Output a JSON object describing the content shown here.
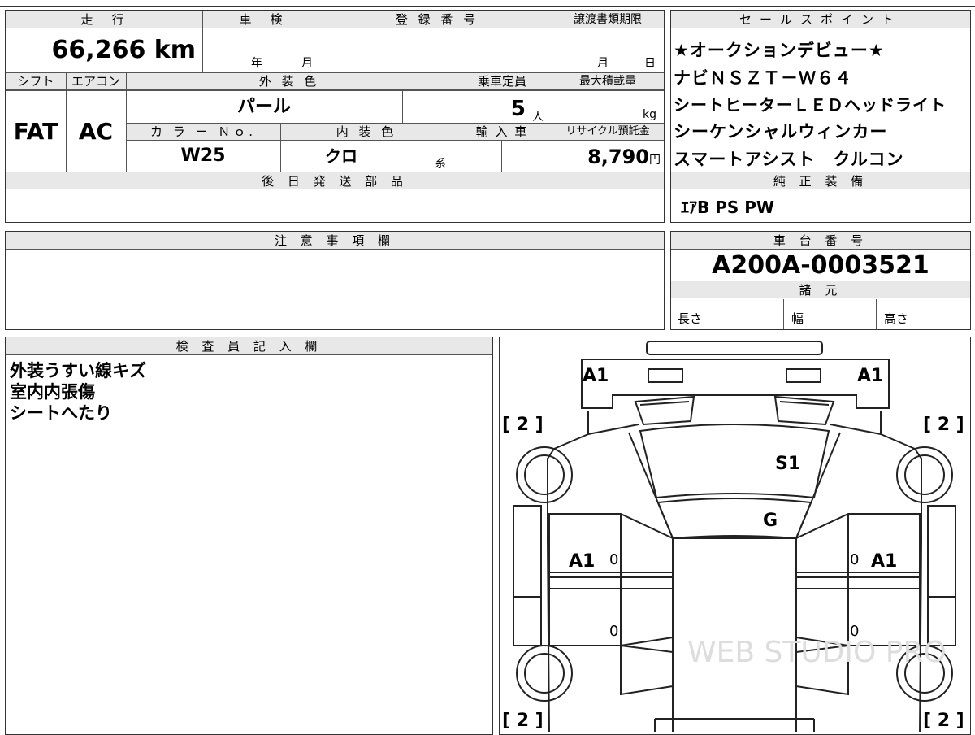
{
  "vehicle": {
    "mileage_header": "走　行",
    "mileage": "66,266",
    "mileage_unit": "km",
    "inspection_header": "車　検",
    "inspection_year_unit": "年",
    "inspection_month_unit": "月",
    "registration_header": "登 録 番 号",
    "transfer_header": "譲渡書類期限",
    "transfer_month_unit": "月",
    "transfer_day_unit": "日",
    "shift_header": "シフト",
    "shift": "FAT",
    "ac_header": "エアコン",
    "ac": "AC",
    "exterior_color_header": "外 装 色",
    "exterior_color": "パール",
    "capacity_header": "乗車定員",
    "capacity": "5",
    "capacity_unit": "人",
    "max_load_header": "最大積載量",
    "max_load_unit": "kg",
    "color_no_header": "カ ラ ー Ｎｏ.",
    "color_no": "W25",
    "interior_color_header": "内 装 色",
    "interior_color": "クロ",
    "interior_color_suffix": "系",
    "import_header": "輸 入 車",
    "recycle_header": "リサイクル預託金",
    "recycle_fee": "8,790",
    "recycle_unit": "円",
    "later_parts_header": "後 日 発 送 部 品"
  },
  "sales_points": {
    "header": "セールスポイント",
    "lines": [
      "★オークションデビュー★",
      "ナビＮＳＺＴ－Ｗ６４",
      "シートヒーターＬＥＤヘッドライト",
      "シーケンシャルウィンカー",
      "スマートアシスト　クルコン"
    ]
  },
  "standard_equipment": {
    "header": "純 正 装 備",
    "value": "ｴｱB PS PW"
  },
  "notes": {
    "header": "注 意 事 項 欄"
  },
  "chassis": {
    "header": "車 台 番 号",
    "number": "A200A-0003521",
    "specs_header": "諸 元",
    "length_label": "長さ",
    "width_label": "幅",
    "height_label": "高さ"
  },
  "inspector": {
    "header": "検 査 員 記 入 欄",
    "lines": [
      "外装うすい線キズ",
      "室内内張傷",
      "シートへたり"
    ]
  },
  "diagram": {
    "labels": {
      "front_left": "A1",
      "front_right": "A1",
      "hood": "S1",
      "windshield": "G",
      "door_left": "A1",
      "door_right": "A1",
      "zero": "0",
      "tire_front_left": "[ 2 ]",
      "tire_front_right": "[ 2 ]",
      "tire_rear_left": "[ 2 ]",
      "tire_rear_right": "[ 2 ]"
    },
    "watermark": "WEB STUDIO PRO"
  },
  "colors": {
    "header_bg": "#e8e8e8",
    "border": "#333333"
  }
}
